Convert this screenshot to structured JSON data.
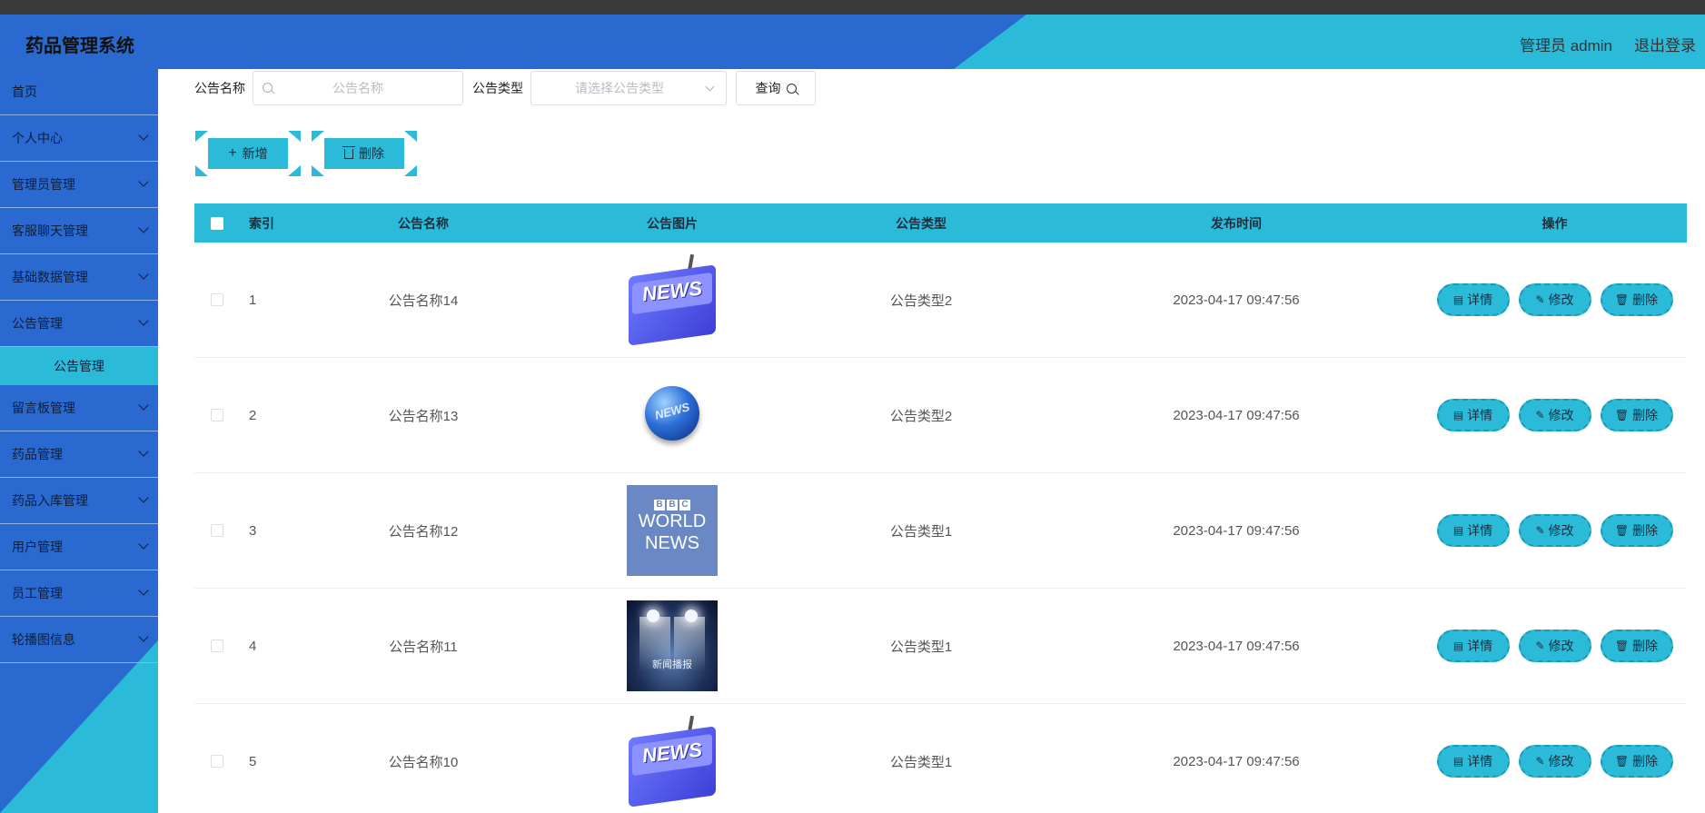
{
  "app": {
    "title": "药品管理系统"
  },
  "header": {
    "user_label": "管理员 admin",
    "logout_label": "退出登录"
  },
  "sidebar": {
    "items": [
      {
        "label": "首页",
        "has_children": false
      },
      {
        "label": "个人中心",
        "has_children": true
      },
      {
        "label": "管理员管理",
        "has_children": true
      },
      {
        "label": "客服聊天管理",
        "has_children": true
      },
      {
        "label": "基础数据管理",
        "has_children": true
      },
      {
        "label": "公告管理",
        "has_children": true,
        "expanded": true
      },
      {
        "label": "公告管理",
        "is_sub": true,
        "active": true
      },
      {
        "label": "留言板管理",
        "has_children": true
      },
      {
        "label": "药品管理",
        "has_children": true
      },
      {
        "label": "药品入库管理",
        "has_children": true
      },
      {
        "label": "用户管理",
        "has_children": true
      },
      {
        "label": "员工管理",
        "has_children": true
      },
      {
        "label": "轮播图信息",
        "has_children": true
      }
    ]
  },
  "filter": {
    "name_label": "公告名称",
    "name_placeholder": "公告名称",
    "type_label": "公告类型",
    "type_placeholder": "请选择公告类型",
    "query_label": "查询"
  },
  "actions": {
    "add_label": "新增",
    "delete_label": "删除"
  },
  "table": {
    "headers": {
      "index": "索引",
      "name": "公告名称",
      "picture": "公告图片",
      "type": "公告类型",
      "time": "发布时间",
      "ops": "操作"
    },
    "op_labels": {
      "detail": "详情",
      "edit": "修改",
      "delete": "删除"
    },
    "rows": [
      {
        "index": "1",
        "name": "公告名称14",
        "picture": "news-keyboard",
        "type": "公告类型2",
        "time": "2023-04-17 09:47:56"
      },
      {
        "index": "2",
        "name": "公告名称13",
        "picture": "news-globe",
        "type": "公告类型2",
        "time": "2023-04-17 09:47:56"
      },
      {
        "index": "3",
        "name": "公告名称12",
        "picture": "bbc-world-news",
        "type": "公告类型1",
        "time": "2023-04-17 09:47:56"
      },
      {
        "index": "4",
        "name": "公告名称11",
        "picture": "news-stage",
        "type": "公告类型1",
        "time": "2023-04-17 09:47:56"
      },
      {
        "index": "5",
        "name": "公告名称10",
        "picture": "news-keyboard",
        "type": "公告类型1",
        "time": "2023-04-17 09:47:56"
      }
    ]
  },
  "thumbs": {
    "news_keyboard_text": "NEWS",
    "globe_text": "NEWS",
    "bbc_letters": [
      "B",
      "B",
      "C"
    ],
    "bbc_line1": "WORLD",
    "bbc_line2": "NEWS",
    "stage_text": "新闻播报"
  },
  "colors": {
    "primary": "#2a6ad0",
    "accent": "#2bbbd8"
  }
}
